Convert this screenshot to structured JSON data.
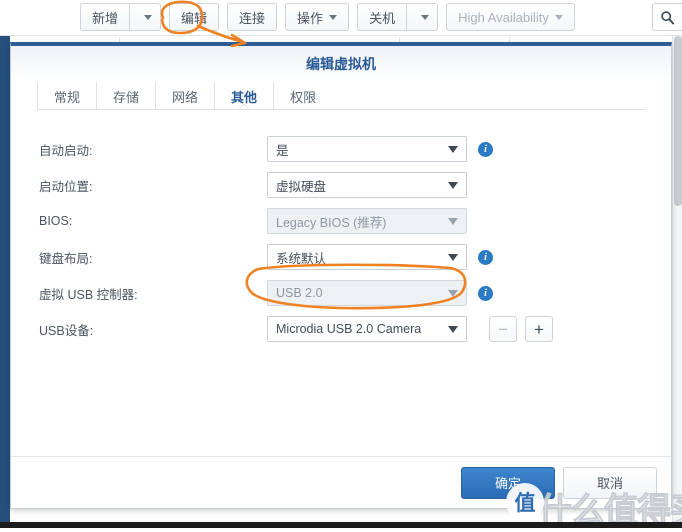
{
  "toolbar": {
    "buttons": [
      {
        "label": "新增",
        "has_split_arrow": true,
        "disabled": false
      },
      {
        "label": "编辑",
        "has_split_arrow": false,
        "disabled": false
      },
      {
        "label": "连接",
        "has_split_arrow": false,
        "disabled": false
      },
      {
        "label": "操作",
        "has_inline_caret": true,
        "disabled": false
      },
      {
        "label": "关机",
        "has_split_arrow": true,
        "disabled": false
      },
      {
        "label": "High Availability",
        "has_inline_caret": true,
        "disabled": true
      }
    ],
    "search_icon": "search-icon"
  },
  "dialog": {
    "title": "编辑虚拟机",
    "tabs": [
      {
        "label": "常规",
        "active": false
      },
      {
        "label": "存储",
        "active": false
      },
      {
        "label": "网络",
        "active": false
      },
      {
        "label": "其他",
        "active": true
      },
      {
        "label": "权限",
        "active": false
      }
    ],
    "rows": [
      {
        "label": "自动启动:",
        "value": "是",
        "disabled": false,
        "info": true,
        "name": "auto-start"
      },
      {
        "label": "启动位置:",
        "value": "虚拟硬盘",
        "disabled": false,
        "info": false,
        "name": "boot-location"
      },
      {
        "label": "BIOS:",
        "value": "Legacy BIOS (推荐)",
        "disabled": true,
        "info": false,
        "name": "bios"
      },
      {
        "label": "键盘布局:",
        "value": "系统默认",
        "disabled": false,
        "info": true,
        "name": "keyboard-layout"
      },
      {
        "label": "虚拟 USB 控制器:",
        "value": "USB 2.0",
        "disabled": true,
        "info": true,
        "name": "virtual-usb-controller"
      },
      {
        "label": "USB设备:",
        "value": "Microdia USB 2.0 Camera",
        "disabled": false,
        "info": false,
        "name": "usb-device"
      }
    ],
    "usb_remove_label": "−",
    "usb_add_label": "+",
    "ok_label": "确定",
    "cancel_label": "取消"
  },
  "watermark": {
    "text": "什么值得买",
    "badge": "值"
  },
  "annotations": {
    "color": "#ef8122",
    "edit_circle_target": "编辑",
    "usb_circle_target": "Microdia USB 2.0 Camera"
  }
}
